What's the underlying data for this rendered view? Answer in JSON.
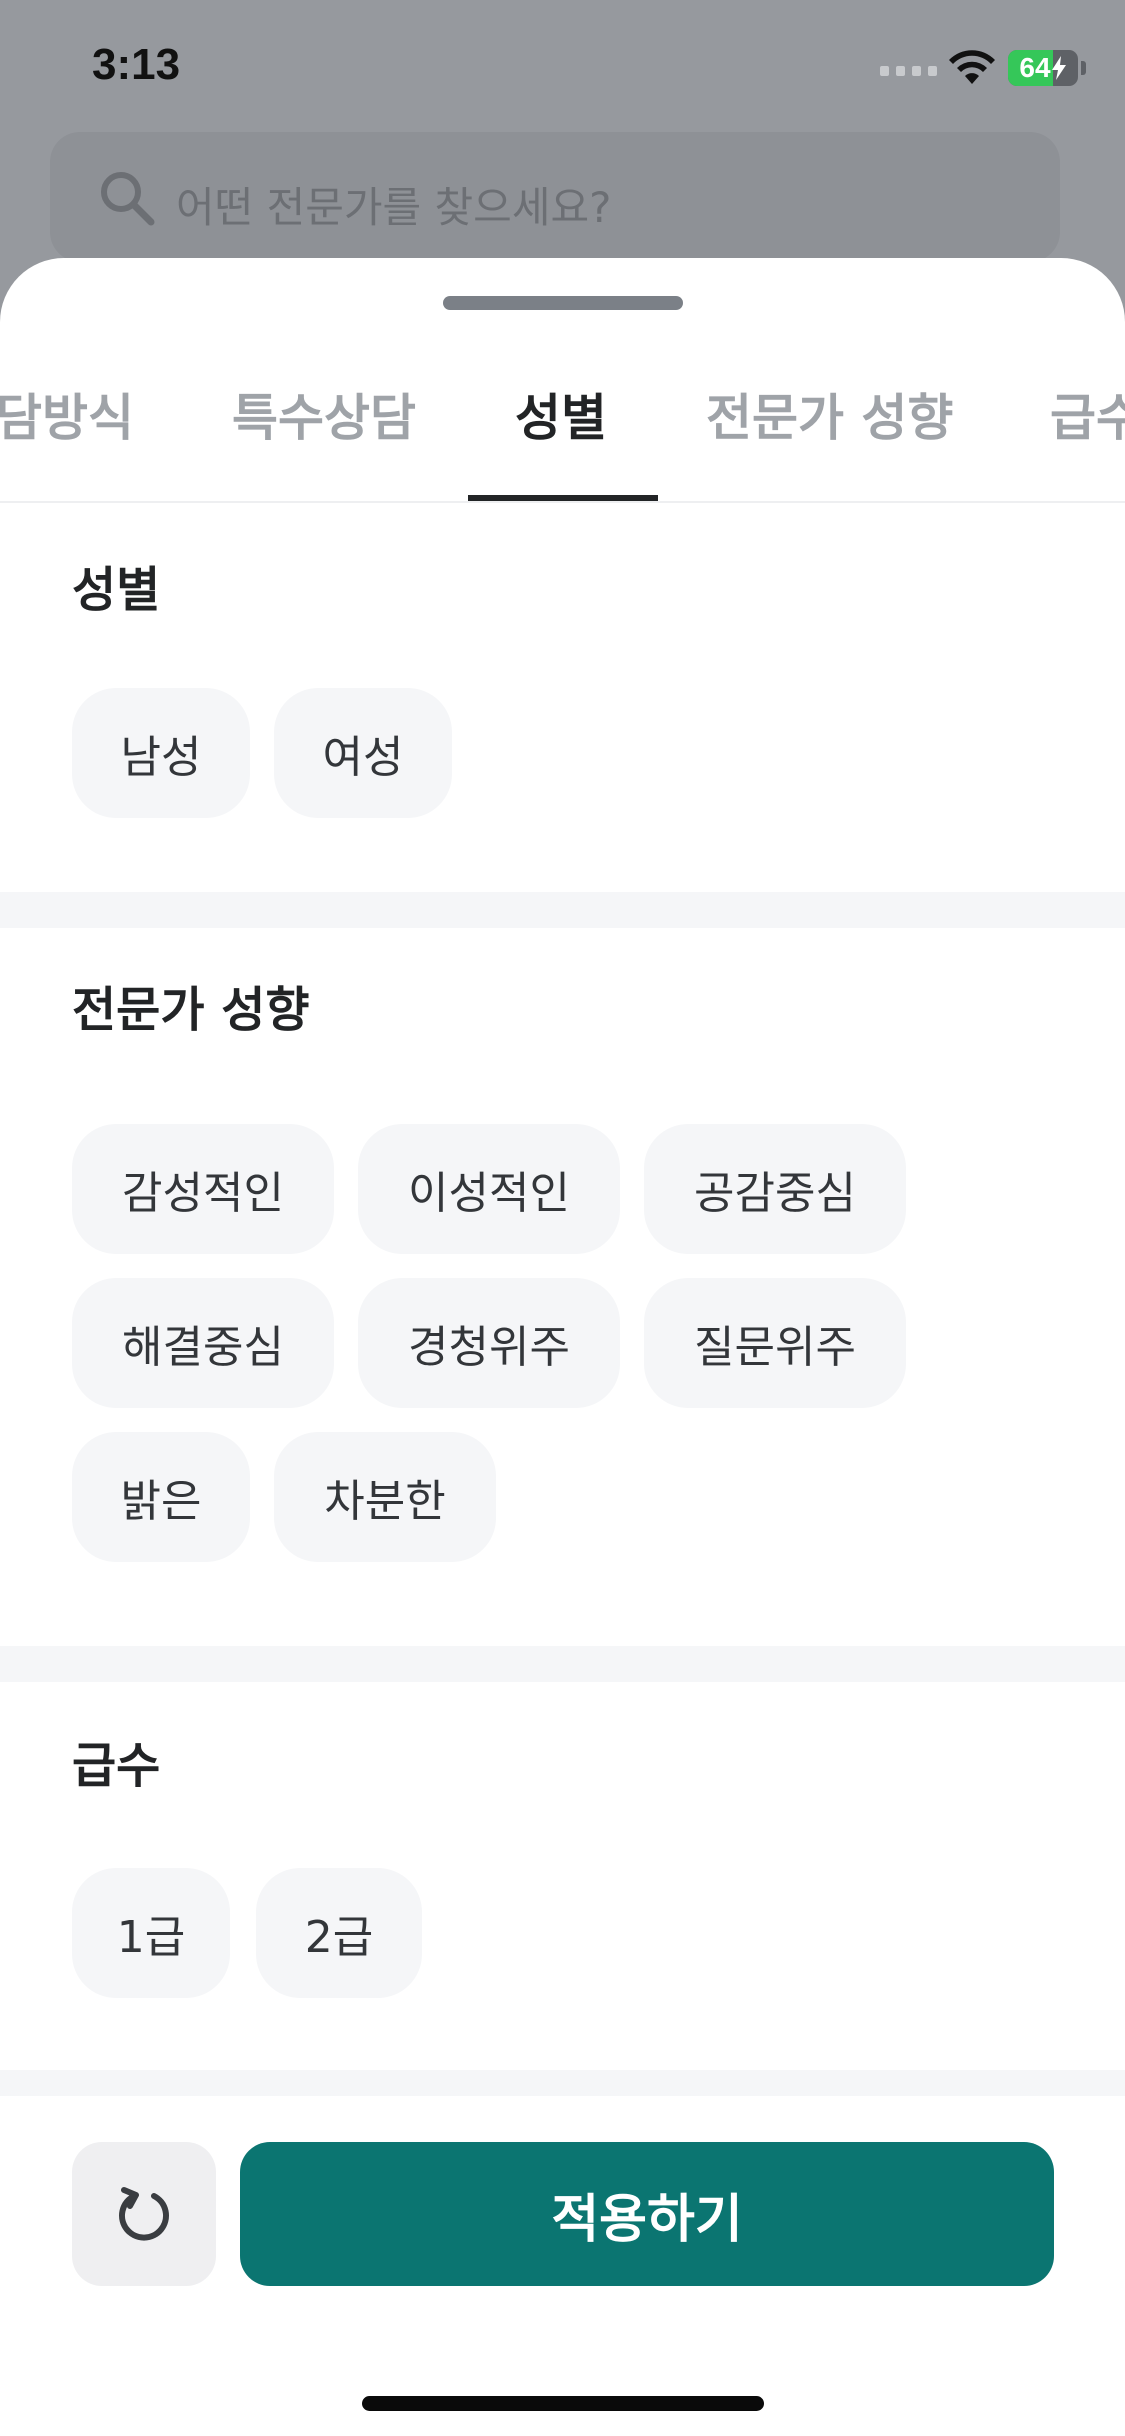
{
  "status_bar": {
    "time": "3:13",
    "battery": "64",
    "battery_level": 0.64
  },
  "search": {
    "placeholder": "어떤 전문가를 찾으세요?",
    "icon": "search-icon"
  },
  "tabs": [
    {
      "label": "담방식"
    },
    {
      "label": "특수상담"
    },
    {
      "label": "성별",
      "active": true
    },
    {
      "label": "전문가 성향"
    },
    {
      "label": "급수"
    }
  ],
  "sections": {
    "gender": {
      "title": "성별",
      "options": [
        "남성",
        "여성"
      ]
    },
    "disposition": {
      "title": "전문가 성향",
      "options": [
        "감성적인",
        "이성적인",
        "공감중심",
        "해결중심",
        "경청위주",
        "질문위주",
        "밝은",
        "차분한"
      ]
    },
    "grade": {
      "title": "급수",
      "options": [
        "1급",
        "2급"
      ]
    }
  },
  "actions": {
    "reset_icon": "refresh-icon",
    "apply_label": "적용하기"
  },
  "colors": {
    "accent": "#0b7571",
    "chip_bg": "#f5f6f8",
    "backdrop": "#96999e"
  }
}
